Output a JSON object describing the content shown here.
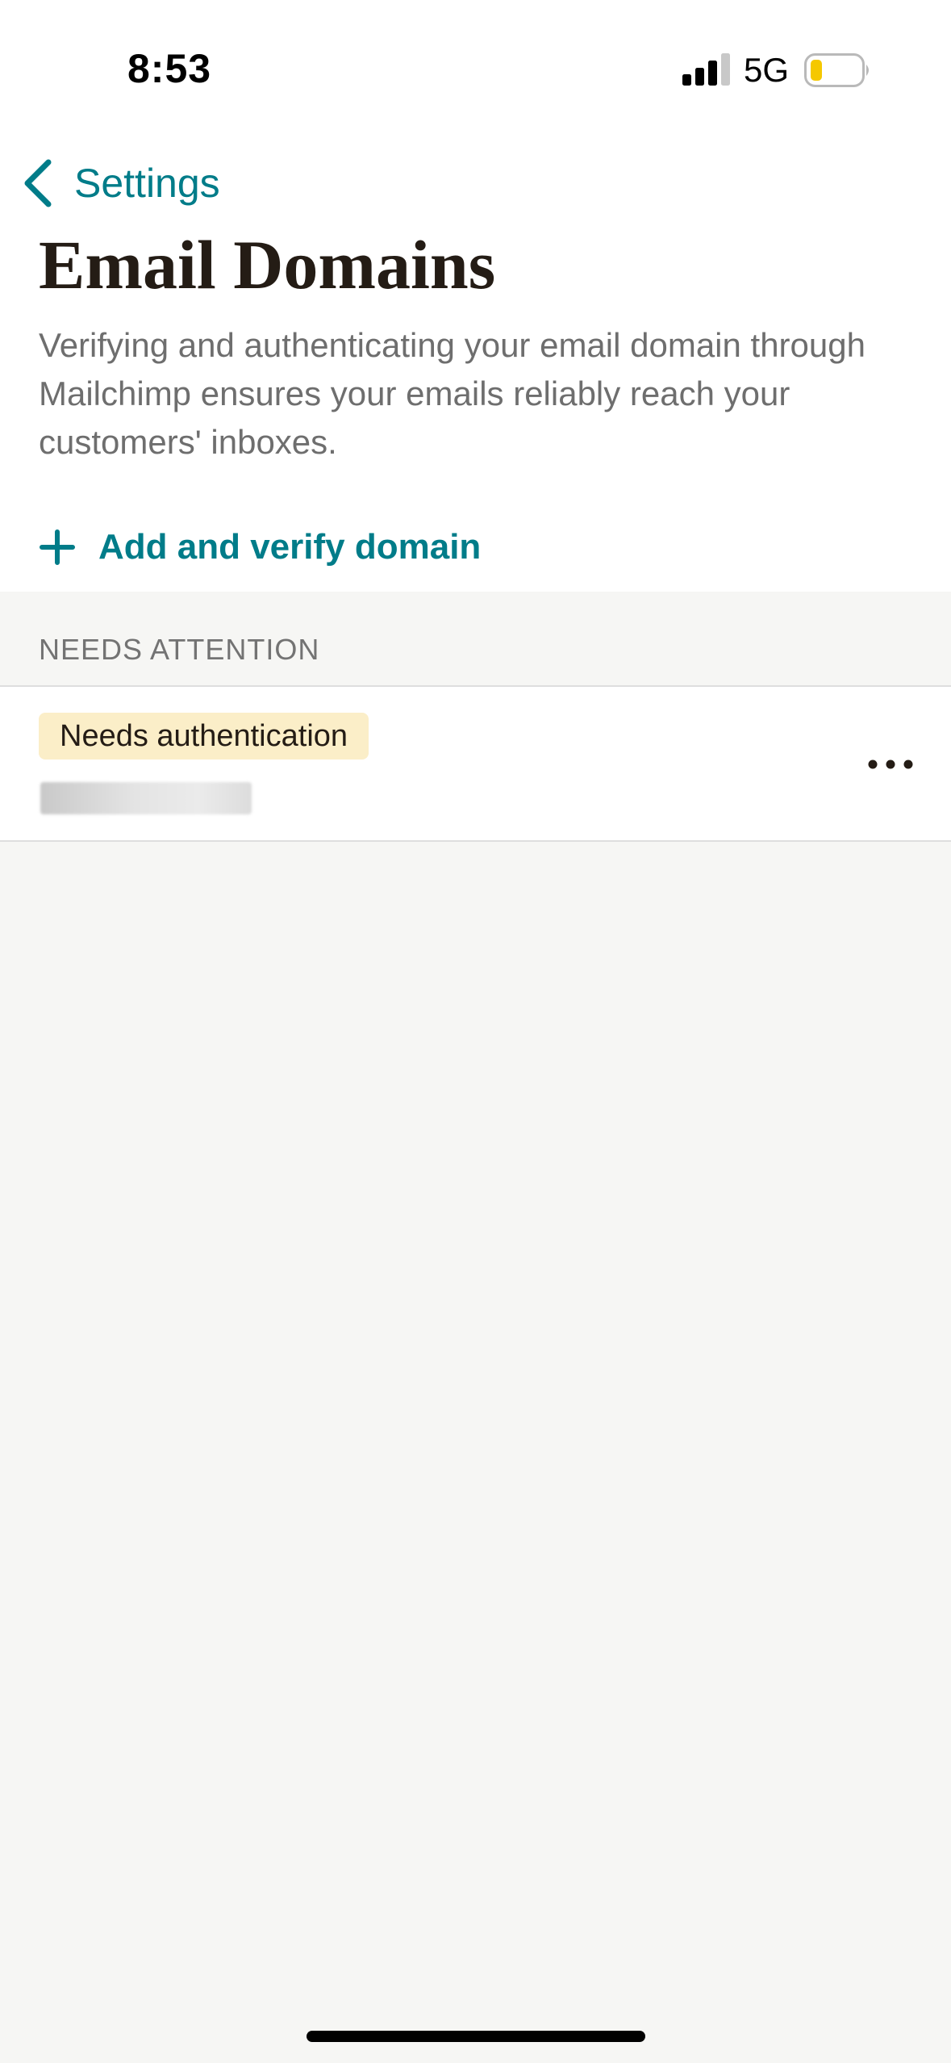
{
  "status_bar": {
    "time": "8:53",
    "network": "5G",
    "icons": {
      "signal": "cellular-signal-icon",
      "battery": "battery-low-icon"
    },
    "battery_color": "#f5c800"
  },
  "nav": {
    "back_label": "Settings",
    "back_icon": "chevron-left-icon"
  },
  "page": {
    "title": "Email Domains",
    "description": "Verifying and authenticating your email domain through Mailchimp ensures your emails reliably reach your customers' inboxes."
  },
  "actions": {
    "add_domain_label": "Add and verify domain",
    "add_icon": "plus-icon"
  },
  "sections": [
    {
      "header": "NEEDS ATTENTION",
      "items": [
        {
          "status": "Needs authentication",
          "domain": "",
          "domain_redacted": true,
          "menu_icon": "more-horizontal-icon"
        }
      ]
    }
  ],
  "colors": {
    "accent": "#007c89",
    "badge_background": "#fbeec8",
    "page_background": "#f6f6f4"
  }
}
